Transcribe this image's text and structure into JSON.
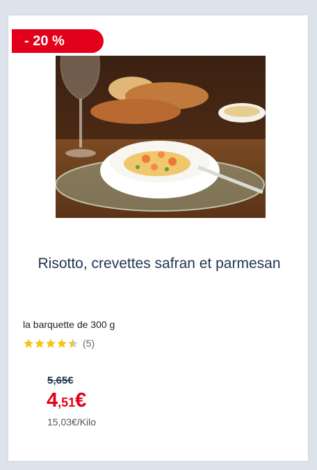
{
  "badge": {
    "discount": "- 20 %"
  },
  "product": {
    "title": "Risotto, crevettes safran et parmesan",
    "unit": "la barquette de 300 g",
    "rating": {
      "stars": 4.5,
      "max": 5,
      "count_label": "(5)"
    },
    "old_price": "5,65€",
    "new_price": {
      "integer": "4",
      "decimal": ",51",
      "currency": "€"
    },
    "price_per_kilo": "15,03€/Kilo"
  },
  "colors": {
    "promo_red": "#e2001a",
    "title_navy": "#1f3550",
    "star_yellow": "#f5c518"
  }
}
